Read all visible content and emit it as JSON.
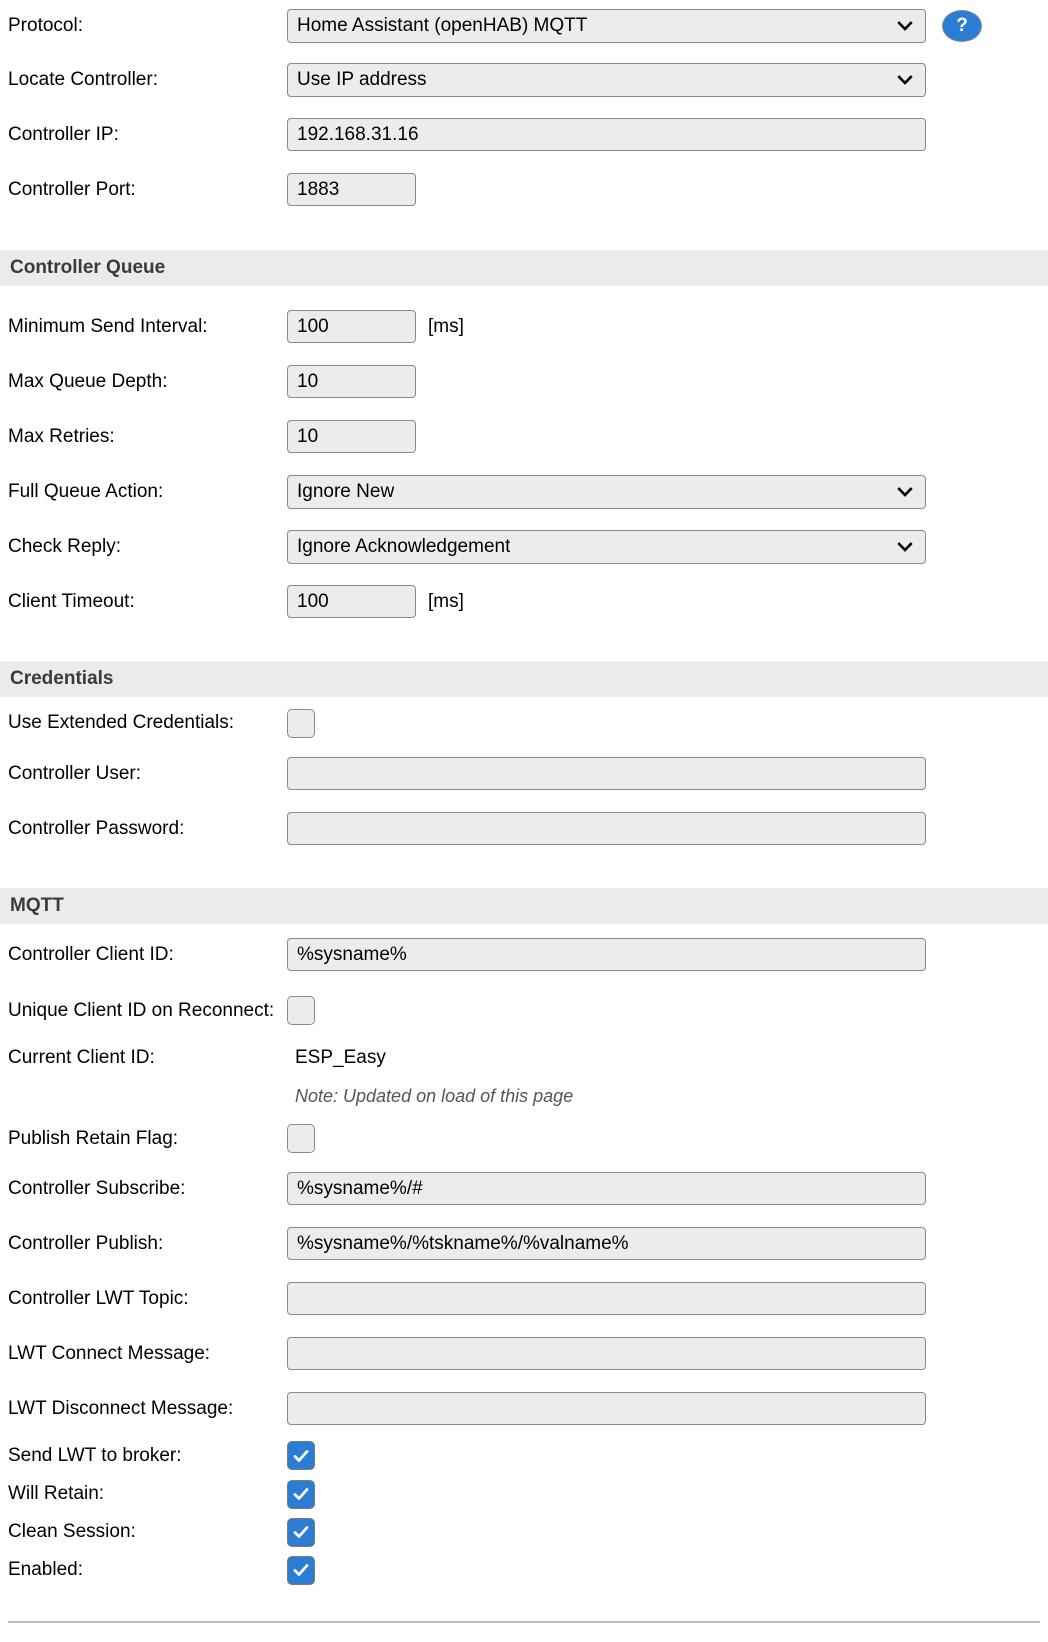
{
  "help": {
    "label": "?"
  },
  "connection": {
    "protocol": {
      "label": "Protocol:",
      "value": "Home Assistant (openHAB) MQTT"
    },
    "locate": {
      "label": "Locate Controller:",
      "value": "Use IP address"
    },
    "ip": {
      "label": "Controller IP:",
      "value": "192.168.31.16"
    },
    "port": {
      "label": "Controller Port:",
      "value": "1883"
    }
  },
  "queue": {
    "section": "Controller Queue",
    "min_send_interval": {
      "label": "Minimum Send Interval:",
      "value": "100",
      "unit": "[ms]"
    },
    "max_queue_depth": {
      "label": "Max Queue Depth:",
      "value": "10"
    },
    "max_retries": {
      "label": "Max Retries:",
      "value": "10"
    },
    "full_queue_action": {
      "label": "Full Queue Action:",
      "value": "Ignore New"
    },
    "check_reply": {
      "label": "Check Reply:",
      "value": "Ignore Acknowledgement"
    },
    "client_timeout": {
      "label": "Client Timeout:",
      "value": "100",
      "unit": "[ms]"
    }
  },
  "credentials": {
    "section": "Credentials",
    "use_extended": {
      "label": "Use Extended Credentials:",
      "checked": false
    },
    "user": {
      "label": "Controller User:",
      "value": "",
      "placeholder": ""
    },
    "password": {
      "label": "Controller Password:",
      "value": "",
      "placeholder": ""
    }
  },
  "mqtt": {
    "section": "MQTT",
    "client_id": {
      "label": "Controller Client ID:",
      "value": "%sysname%"
    },
    "unique_client_id": {
      "label": "Unique Client ID on Reconnect:",
      "checked": false
    },
    "current_client_id": {
      "label": "Current Client ID:",
      "value": "ESP_Easy"
    },
    "note": "Note: Updated on load of this page",
    "publish_retain": {
      "label": "Publish Retain Flag:",
      "checked": false
    },
    "subscribe": {
      "label": "Controller Subscribe:",
      "value": "%sysname%/#"
    },
    "publish": {
      "label": "Controller Publish:",
      "value": "%sysname%/%tskname%/%valname%"
    },
    "lwt_topic": {
      "label": "Controller LWT Topic:",
      "value": ""
    },
    "lwt_connect": {
      "label": "LWT Connect Message:",
      "value": ""
    },
    "lwt_disconnect": {
      "label": "LWT Disconnect Message:",
      "value": ""
    },
    "send_lwt": {
      "label": "Send LWT to broker:",
      "checked": true
    },
    "will_retain": {
      "label": "Will Retain:",
      "checked": true
    },
    "clean_session": {
      "label": "Clean Session:",
      "checked": true
    },
    "enabled": {
      "label": "Enabled:",
      "checked": true
    }
  },
  "colors": {
    "accent": "#2b7cd3",
    "section_bg": "#ebebeb",
    "field_bg": "#ececec",
    "field_border": "#8a8a8a"
  }
}
